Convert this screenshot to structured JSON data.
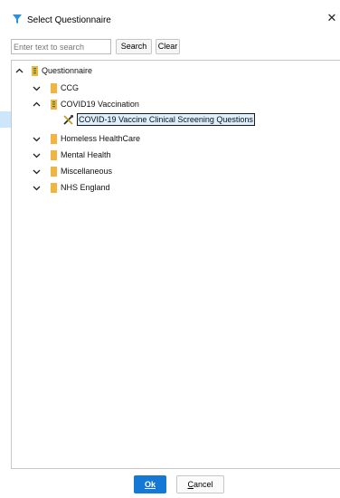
{
  "window": {
    "title": "Select Questionnaire",
    "close_symbol": "✕"
  },
  "search": {
    "placeholder": "Enter text to search",
    "value": "",
    "search_label": "Search",
    "clear_label": "Clear"
  },
  "tree": {
    "root": {
      "label": "Questionnaire",
      "expanded": true
    },
    "items": [
      {
        "label": "CCG",
        "expanded": false
      },
      {
        "label": "COVID19 Vaccination",
        "expanded": true
      },
      {
        "label": "COVID-19 Vaccine Clinical Screening Questions",
        "selected": true
      },
      {
        "label": "Homeless HealthCare",
        "expanded": false
      },
      {
        "label": "Mental Health",
        "expanded": false
      },
      {
        "label": "Miscellaneous",
        "expanded": false
      },
      {
        "label": "NHS England",
        "expanded": false
      }
    ]
  },
  "footer": {
    "ok_label": "Ok",
    "cancel_first": "C",
    "cancel_rest": "ancel"
  },
  "colors": {
    "accent": "#1478d4",
    "selection": "#cce6fb",
    "folder": "#f2b441",
    "questionnaire_icon": "#3b7d2c"
  },
  "icons": {
    "title": "funnel-icon",
    "folder": "folder-icon",
    "questionnaire": "questionnaire-book-icon",
    "leaf": "tools-icon",
    "expanded": "chevron-up-icon",
    "collapsed": "chevron-down-icon"
  }
}
